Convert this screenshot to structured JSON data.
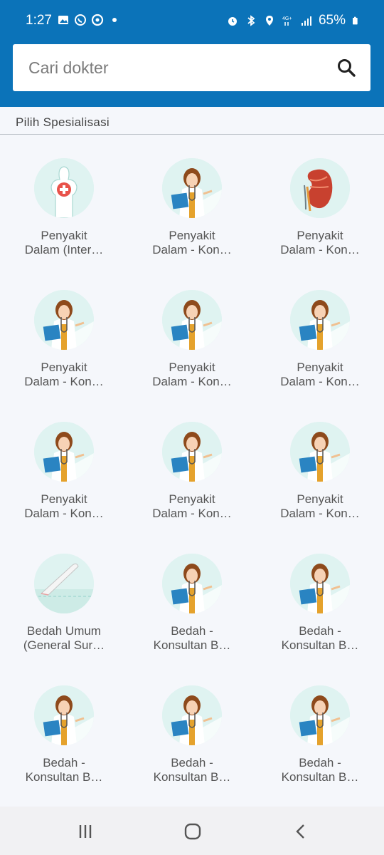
{
  "status_bar": {
    "time": "1:27",
    "left_icons": [
      "gallery-icon",
      "whatsapp-icon",
      "app-icon",
      "dot-icon"
    ],
    "right_icons": [
      "alarm-icon",
      "bluetooth-icon",
      "location-icon",
      "4g-icon",
      "signal-icon",
      "battery-icon"
    ],
    "battery": "65%"
  },
  "search": {
    "placeholder": "Cari dokter",
    "value": ""
  },
  "section_title": "Pilih Spesialisasi",
  "specializations": [
    {
      "line1": "Penyakit",
      "line2": "Dalam (Inter…",
      "icon": "body-cross-icon"
    },
    {
      "line1": "Penyakit",
      "line2": "Dalam - Kon…",
      "icon": "doctor-icon"
    },
    {
      "line1": "Penyakit",
      "line2": "Dalam - Kon…",
      "icon": "kidney-icon"
    },
    {
      "line1": "Penyakit",
      "line2": "Dalam - Kon…",
      "icon": "doctor-icon"
    },
    {
      "line1": "Penyakit",
      "line2": "Dalam - Kon…",
      "icon": "doctor-icon"
    },
    {
      "line1": "Penyakit",
      "line2": "Dalam - Kon…",
      "icon": "doctor-icon"
    },
    {
      "line1": "Penyakit",
      "line2": "Dalam - Kon…",
      "icon": "doctor-icon"
    },
    {
      "line1": "Penyakit",
      "line2": "Dalam - Kon…",
      "icon": "doctor-icon"
    },
    {
      "line1": "Penyakit",
      "line2": "Dalam - Kon…",
      "icon": "doctor-icon"
    },
    {
      "line1": "Bedah Umum",
      "line2": "(General Sur…",
      "icon": "scalpel-icon"
    },
    {
      "line1": "Bedah -",
      "line2": "Konsultan B…",
      "icon": "doctor-icon"
    },
    {
      "line1": "Bedah -",
      "line2": "Konsultan B…",
      "icon": "doctor-icon"
    },
    {
      "line1": "Bedah -",
      "line2": "Konsultan B…",
      "icon": "doctor-icon"
    },
    {
      "line1": "Bedah -",
      "line2": "Konsultan B…",
      "icon": "doctor-icon"
    },
    {
      "line1": "Bedah -",
      "line2": "Konsultan B…",
      "icon": "doctor-icon"
    }
  ],
  "nav": {
    "recents": "recents-icon",
    "home": "home-icon",
    "back": "back-icon"
  },
  "colors": {
    "header": "#0b73b9",
    "avatar_bg": "#dff3f1",
    "background": "#f5f7fb"
  }
}
